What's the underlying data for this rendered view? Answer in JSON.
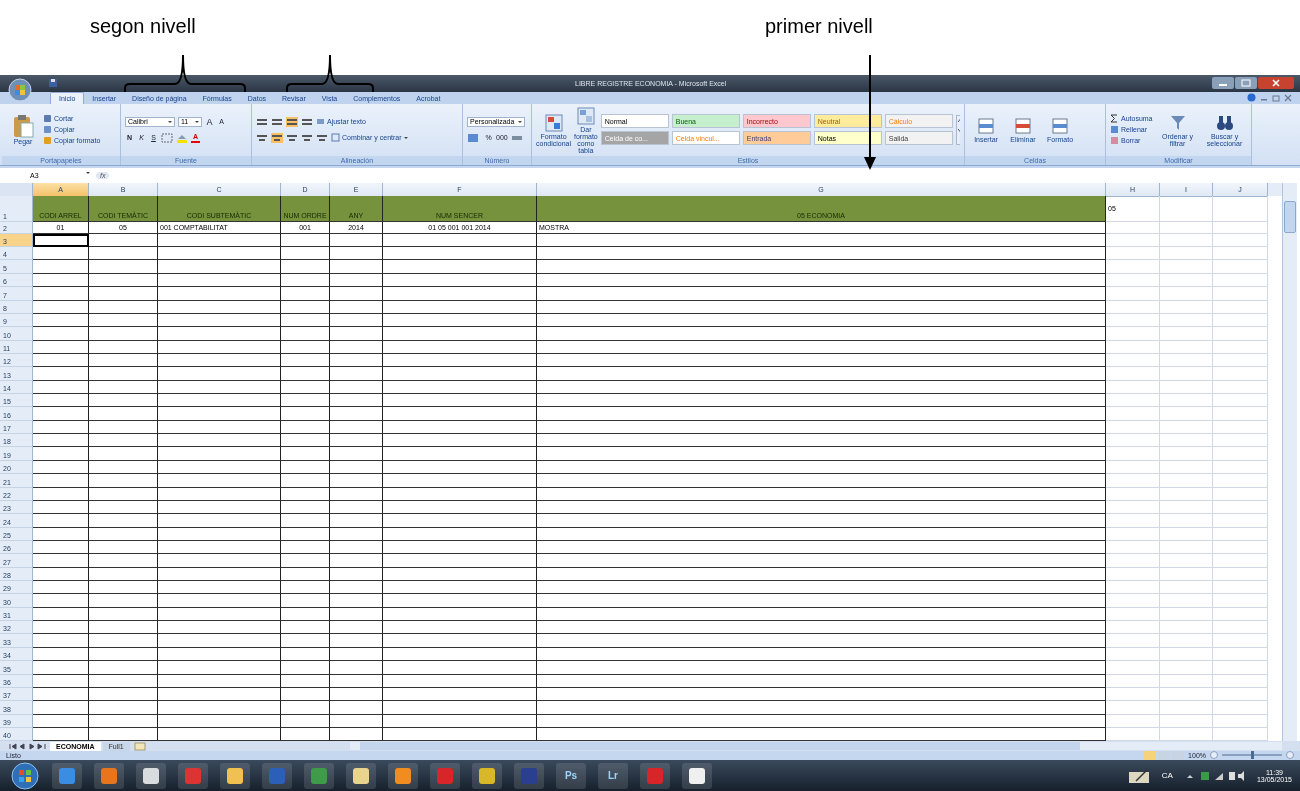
{
  "annotations": [
    {
      "text": "segon nivell"
    },
    {
      "text": "primer nivell"
    }
  ],
  "window": {
    "title": "LIBRE REGISTRE ECONOMIA - Microsoft Excel"
  },
  "tabs": [
    {
      "label": "Inicio",
      "selected": true
    },
    {
      "label": "Insertar",
      "selected": false
    },
    {
      "label": "Diseño de página",
      "selected": false
    },
    {
      "label": "Fórmulas",
      "selected": false
    },
    {
      "label": "Datos",
      "selected": false
    },
    {
      "label": "Revisar",
      "selected": false
    },
    {
      "label": "Vista",
      "selected": false
    },
    {
      "label": "Complementos",
      "selected": false
    },
    {
      "label": "Acrobat",
      "selected": false
    }
  ],
  "ribbon": {
    "groups": [
      {
        "kind": "clipboard",
        "label": "Portapapeles",
        "big": [
          "Pegar"
        ],
        "items": [
          "Cortar",
          "Copiar",
          "Copiar formato"
        ]
      },
      {
        "kind": "font",
        "label": "Fuente",
        "font": "Calibri",
        "size": "11",
        "size_buttons": [
          "A",
          "A"
        ],
        "buttons": [
          "N",
          "K",
          "S"
        ],
        "color_button": "A"
      },
      {
        "kind": "align",
        "label": "Alineación",
        "items": [
          "Ajustar texto",
          "Combinar y centrar"
        ]
      },
      {
        "kind": "number",
        "label": "Número",
        "format": "Personalizada",
        "buttons": [
          "%",
          "000"
        ]
      },
      {
        "kind": "styles",
        "label": "Estilos",
        "big": [
          "Formato condicional",
          "Dar formato como tabla"
        ],
        "styles": [
          {
            "label": "Normal",
            "color": "#ffffff"
          },
          {
            "label": "Buena",
            "color": "#c6efce"
          },
          {
            "label": "Incorrecto",
            "color": "#ffc7ce"
          },
          {
            "label": "Neutral",
            "color": "#ffeb9c"
          },
          {
            "label": "Cálculo",
            "color": "#f2f2f2"
          },
          {
            "label": "Celda de co...",
            "color": "#a5a5a5"
          },
          {
            "label": "Celda vincul...",
            "color": "#ffffff"
          },
          {
            "label": "Entrada",
            "color": "#ffcc99"
          },
          {
            "label": "Notas",
            "color": "#ffffcc"
          },
          {
            "label": "Salida",
            "color": "#f2f2f2"
          }
        ]
      },
      {
        "kind": "cells",
        "label": "Celdas",
        "big": [
          "Insertar",
          "Eliminar",
          "Formato"
        ]
      },
      {
        "kind": "edit",
        "label": "Modificar",
        "items": [
          "Autosuma",
          "Rellenar",
          "Borrar"
        ],
        "big": [
          "Ordenar y filtrar",
          "Buscar y seleccionar"
        ]
      }
    ]
  },
  "formula_bar": {
    "name_box": "A3",
    "fx": "fx"
  },
  "columns": [
    {
      "label": "A",
      "selected": true
    },
    {
      "label": "B",
      "selected": false
    },
    {
      "label": "C",
      "selected": false
    },
    {
      "label": "D",
      "selected": false
    },
    {
      "label": "E",
      "selected": false
    },
    {
      "label": "F",
      "selected": false
    },
    {
      "label": "G",
      "selected": false
    },
    {
      "label": "H",
      "selected": false
    },
    {
      "label": "I",
      "selected": false
    },
    {
      "label": "J",
      "selected": false
    }
  ],
  "rows": [
    {
      "number": "1",
      "kind": "header",
      "selected": false,
      "cells": [
        "CODI ARREL",
        "CODI TEMÀTIC",
        "CODI SUBTEMÀTIC",
        "NUM ORDRE",
        "ANY",
        "NUM SENCER",
        "05 ECONOMIA",
        "05"
      ]
    },
    {
      "number": "2",
      "kind": "data",
      "selected": false,
      "cells": [
        "01",
        "05",
        "001 COMPTABILITAT",
        "001",
        "2014",
        "01 05 001 001 2014",
        "MOSTRA"
      ]
    },
    {
      "number": "3",
      "selected": true
    },
    {
      "number": "4",
      "selected": false
    },
    {
      "number": "5",
      "selected": false
    },
    {
      "number": "6",
      "selected": false
    },
    {
      "number": "7",
      "selected": false
    },
    {
      "number": "8",
      "selected": false
    },
    {
      "number": "9",
      "selected": false
    },
    {
      "number": "10",
      "selected": false
    },
    {
      "number": "11",
      "selected": false
    },
    {
      "number": "12",
      "selected": false
    },
    {
      "number": "13",
      "selected": false
    },
    {
      "number": "14",
      "selected": false
    },
    {
      "number": "15",
      "selected": false
    },
    {
      "number": "16",
      "selected": false
    },
    {
      "number": "17",
      "selected": false
    },
    {
      "number": "18",
      "selected": false
    },
    {
      "number": "19",
      "selected": false
    },
    {
      "number": "20",
      "selected": false
    },
    {
      "number": "21",
      "selected": false
    },
    {
      "number": "22",
      "selected": false
    },
    {
      "number": "23",
      "selected": false
    },
    {
      "number": "24",
      "selected": false
    },
    {
      "number": "25",
      "selected": false
    },
    {
      "number": "26",
      "selected": false
    },
    {
      "number": "27",
      "selected": false
    },
    {
      "number": "28",
      "selected": false
    },
    {
      "number": "29",
      "selected": false
    },
    {
      "number": "30",
      "selected": false
    },
    {
      "number": "31",
      "selected": false
    },
    {
      "number": "32",
      "selected": false
    },
    {
      "number": "33",
      "selected": false
    },
    {
      "number": "34",
      "selected": false
    },
    {
      "number": "35",
      "selected": false
    },
    {
      "number": "36",
      "selected": false
    },
    {
      "number": "37",
      "selected": false
    },
    {
      "number": "38",
      "selected": false
    },
    {
      "number": "39",
      "selected": false
    },
    {
      "number": "40",
      "selected": false
    }
  ],
  "sheet_tabs": [
    {
      "label": "ECONOMIA",
      "selected": true
    },
    {
      "label": "Full1",
      "selected": false
    }
  ],
  "status_bar": {
    "text": "Listo",
    "zoom": "100%",
    "zoom_level": {
      "level": 0.5
    }
  },
  "taskbar": {
    "labeled_apps": [
      "Ps",
      "Lr"
    ],
    "language": "CA",
    "time": "11:39",
    "date": "13/05/2015"
  }
}
